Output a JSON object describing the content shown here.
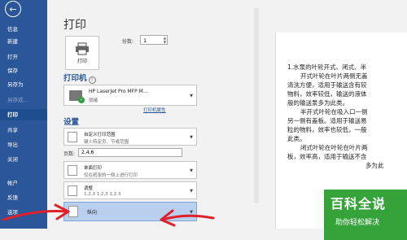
{
  "sidebar": {
    "back_icon": "back-arrow-icon",
    "items": [
      {
        "label": "信息"
      },
      {
        "label": "新建"
      },
      {
        "label": "打开"
      },
      {
        "label": "保存"
      },
      {
        "label": "另存为"
      },
      {
        "label": "另存成…"
      },
      {
        "label": "打印"
      },
      {
        "label": "共享"
      },
      {
        "label": "导出"
      },
      {
        "label": "关闭"
      },
      {
        "label": "帐户"
      },
      {
        "label": "反馈"
      },
      {
        "label": "选项"
      }
    ]
  },
  "print": {
    "title": "打印",
    "print_button": "打印",
    "copies_label": "份数:",
    "copies_value": "1"
  },
  "printer": {
    "heading": "打印机",
    "name": "HP LaserJet Pro MFP M...",
    "status": "就绪",
    "properties_link": "打印机属性"
  },
  "settings": {
    "heading": "设置",
    "range_l1": "自定义打印范围",
    "range_l2": "键入特定页、节或范围",
    "pages_label": "页数:",
    "pages_value": "2,4,6",
    "sides_l1": "单面打印",
    "sides_l2": "仅在纸张的一侧上进行打印",
    "collate_l1": "调整",
    "collate_l2": "1,2,3   1,2,3   1,2,3",
    "orientation": "纵向"
  },
  "preview": {
    "lines": [
      "1.水泵的叶轮开式、闭式、半",
      "开式叶轮在叶片两侧无盖",
      "清洗方便，适用于输送含有较",
      "物料，效率较低，输送的液体",
      "般的输送泵多为此类。",
      "半开式叶轮在吸入口一侧",
      "另一侧有盖板。适用于输送易",
      "粒的物料，效率也较低，一般",
      "此类。",
      "闭式叶轮在叶轮在叶片两",
      "板，效率高，适用于输送不含",
      "多为此"
    ]
  },
  "watermark": {
    "title": "百科全说",
    "subtitle": "助你轻松解决"
  },
  "colors": {
    "sidebar": "#2b579a",
    "accent": "#2b579a",
    "watermark": "#35a33a",
    "annotation": "#e0202a"
  }
}
